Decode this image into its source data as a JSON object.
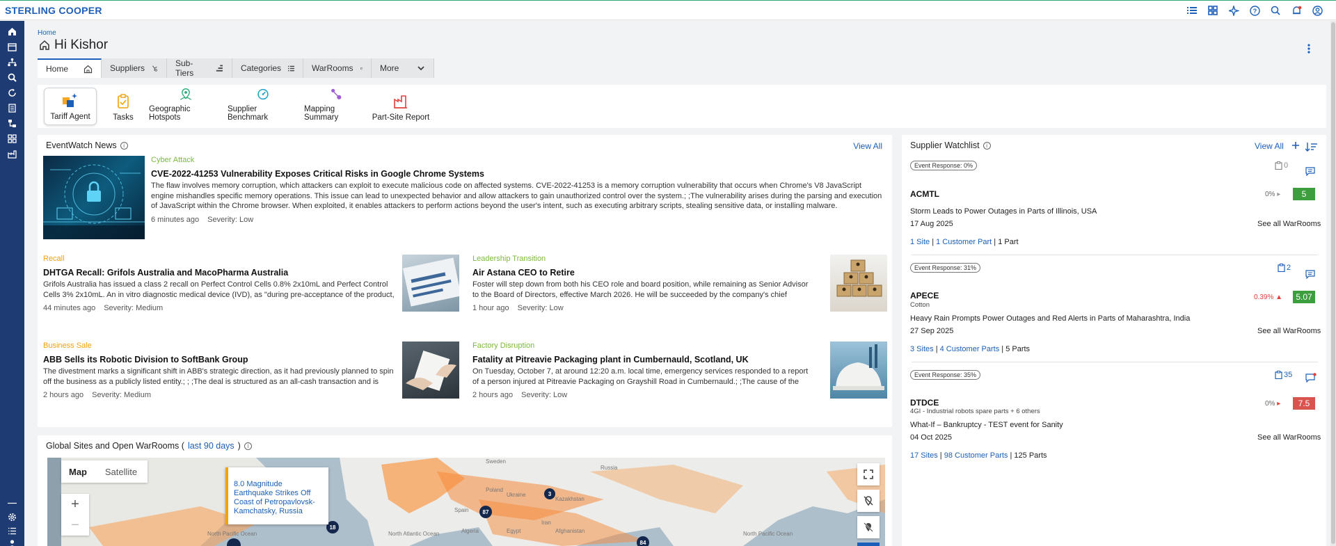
{
  "app": {
    "brand": "STERLING COOPER"
  },
  "header_icons": [
    "list-view-icon",
    "grid-view-icon",
    "ai-sparkle-icon",
    "help-icon",
    "search-icon",
    "notifications-icon",
    "user-account-icon"
  ],
  "sidebar_icons": [
    "home-icon",
    "calendar-icon",
    "network-icon",
    "search-icon",
    "refresh-icon",
    "report-icon",
    "hierarchy-icon",
    "apps-icon",
    "factory-icon",
    "settings-icon",
    "checklist-icon",
    "user-icon"
  ],
  "breadcrumb": "Home",
  "greeting": "Hi Kishor",
  "tabs": [
    {
      "label": "Home",
      "icon": "home-icon",
      "active": true
    },
    {
      "label": "Suppliers",
      "icon": "supplier-icon"
    },
    {
      "label": "Sub-Tiers",
      "icon": "sub-tier-icon"
    },
    {
      "label": "Categories",
      "icon": "categories-icon"
    },
    {
      "label": "WarRooms",
      "icon": "calendar-icon"
    },
    {
      "label": "More",
      "icon": "chevron-down-icon"
    }
  ],
  "quick_actions": [
    {
      "label": "Tariff Agent",
      "icon": "tariff-agent-icon",
      "selected": true
    },
    {
      "label": "Tasks",
      "icon": "tasks-icon"
    },
    {
      "label": "Geographic Hotspots",
      "icon": "map-pin-icon"
    },
    {
      "label": "Supplier Benchmark",
      "icon": "gauge-icon"
    },
    {
      "label": "Mapping Summary",
      "icon": "mapping-icon"
    },
    {
      "label": "Part-Site Report",
      "icon": "factory-report-icon"
    }
  ],
  "news": {
    "title": "EventWatch News",
    "view_all": "View All",
    "featured": {
      "category": "Cyber Attack",
      "title": "CVE-2022-41253 Vulnerability Exposes Critical Risks in Google Chrome Systems",
      "desc": "The flaw involves memory corruption, which attackers can exploit to execute malicious code on affected systems. CVE-2022-41253 is a memory corruption vulnerability that occurs when Chrome's V8 JavaScript engine mishandles specific memory operations. This issue can lead to unexpected behavior and allow attackers to gain unauthorized control over the system.; ;The vulnerability arises during the parsing and execution of JavaScript within the Chrome browser. When exploited, it enables attackers to perform actions beyond the user's intent, such as executing arbitrary scripts, stealing sensitive data, or installing malware. Cybercriminals can leverage this fla...",
      "time": "6 minutes ago",
      "severity": "Severity: Low",
      "category_color": "#7cba3b"
    },
    "items": [
      {
        "category": "Recall",
        "category_color": "#f0a30a",
        "title": "DHTGA Recall: Grifols Australia and MacoPharma Australia",
        "desc": "Grifols Australia has issued a class 2 recall on Perfect Control Cells 0.8% 2x10mL and Perfect Control Cells 3% 2x10mL. An in vitro diagnostic medical device (IVD), as \"during pre-acceptance of the product, a custom...",
        "time": "44 minutes ago",
        "severity": "Severity: Medium"
      },
      {
        "category": "Leadership Transition",
        "category_color": "#7cba3b",
        "title": "Air Astana CEO to Retire",
        "desc": "Foster will step down from both his CEO role and board position, while remaining as Senior Advisor to the Board of Directors, effective March 2026. He will be succeeded by the company's chief executive officer...",
        "time": "1 hour ago",
        "severity": "Severity: Low"
      },
      {
        "category": "Business Sale",
        "category_color": "#f0a30a",
        "title": "ABB Sells its Robotic Division to SoftBank Group",
        "desc": "The divestment marks a significant shift in ABB's strategic direction, as it had previously planned to spin off the business as a publicly listed entity.; ; ;The deal is structured as an all-cash transaction and is expected to...",
        "time": "2 hours ago",
        "severity": "Severity: Medium"
      },
      {
        "category": "Factory Disruption",
        "category_color": "#7cba3b",
        "title": "Fatality at Pitreavie Packaging plant in Cumbernauld, Scotland, UK",
        "desc": "On Tuesday, October 7, at around 12:20 a.m. local time, emergency services responded to a report of a person injured at Pitreavie Packaging on Grayshill Road in Cumbernauld.; ;The cause of the fatality has not...",
        "time": "2 hours ago",
        "severity": "Severity: Low"
      }
    ]
  },
  "sites": {
    "title_prefix": "Global Sites and Open WarRooms (",
    "title_link": "last 90 days",
    "title_suffix": ")",
    "map_tab": "Map",
    "satellite_tab": "Satellite",
    "zoom_in": "+",
    "zoom_out": "−",
    "popup": "8.0 Magnitude Earthquake Strikes Off Coast of Petropavlovsk-Kamchatsky, Russia",
    "markers": [
      "3",
      "87",
      "18",
      "84"
    ],
    "labels": [
      "Sweden",
      "Russia",
      "Poland",
      "Ukraine",
      "Kazakhstan",
      "Spain",
      "Algeria",
      "Egypt",
      "Iran",
      "Afghanistan",
      "North Atlantic Ocean",
      "North Pacific Ocean",
      "North Pacific Ocean"
    ]
  },
  "watchlist": {
    "title": "Supplier Watchlist",
    "view_all": "View All",
    "items": [
      {
        "event_response": "Event Response: 0%",
        "count": "0",
        "name": "ACMTL",
        "sub": "",
        "pct": "0%",
        "score": "5",
        "score_color": "#3c9e3c",
        "event": "Storm Leads to Power Outages in Parts of Illinois, USA",
        "date": "17 Aug 2025",
        "see_all": "See all WarRooms",
        "sites": "1 Site",
        "parts_link": "1 Customer Part",
        "parts": "1 Part"
      },
      {
        "event_response": "Event Response: 31%",
        "count": "2",
        "name": "APECE",
        "sub": "Cotton",
        "pct": "0.39%",
        "score": "5.07",
        "score_color": "#3c9e3c",
        "event": "Heavy Rain Prompts Power Outages and Red Alerts in Parts of Maharashtra, India",
        "date": "27 Sep 2025",
        "see_all": "See all WarRooms",
        "sites": "3 Sites",
        "parts_link": "4 Customer Parts",
        "parts": "5 Parts"
      },
      {
        "event_response": "Event Response: 35%",
        "count": "35",
        "name": "DTDCE",
        "sub": "4GI - Industrial robots spare parts + 6 others",
        "pct": "0%",
        "score": "7.5",
        "score_color": "#d9534f",
        "event": "What-If – Bankruptcy - TEST event for Sanity",
        "date": "04 Oct 2025",
        "see_all": "See all WarRooms",
        "sites": "17 Sites",
        "parts_link": "98 Customer Parts",
        "parts": "125 Parts"
      }
    ]
  }
}
